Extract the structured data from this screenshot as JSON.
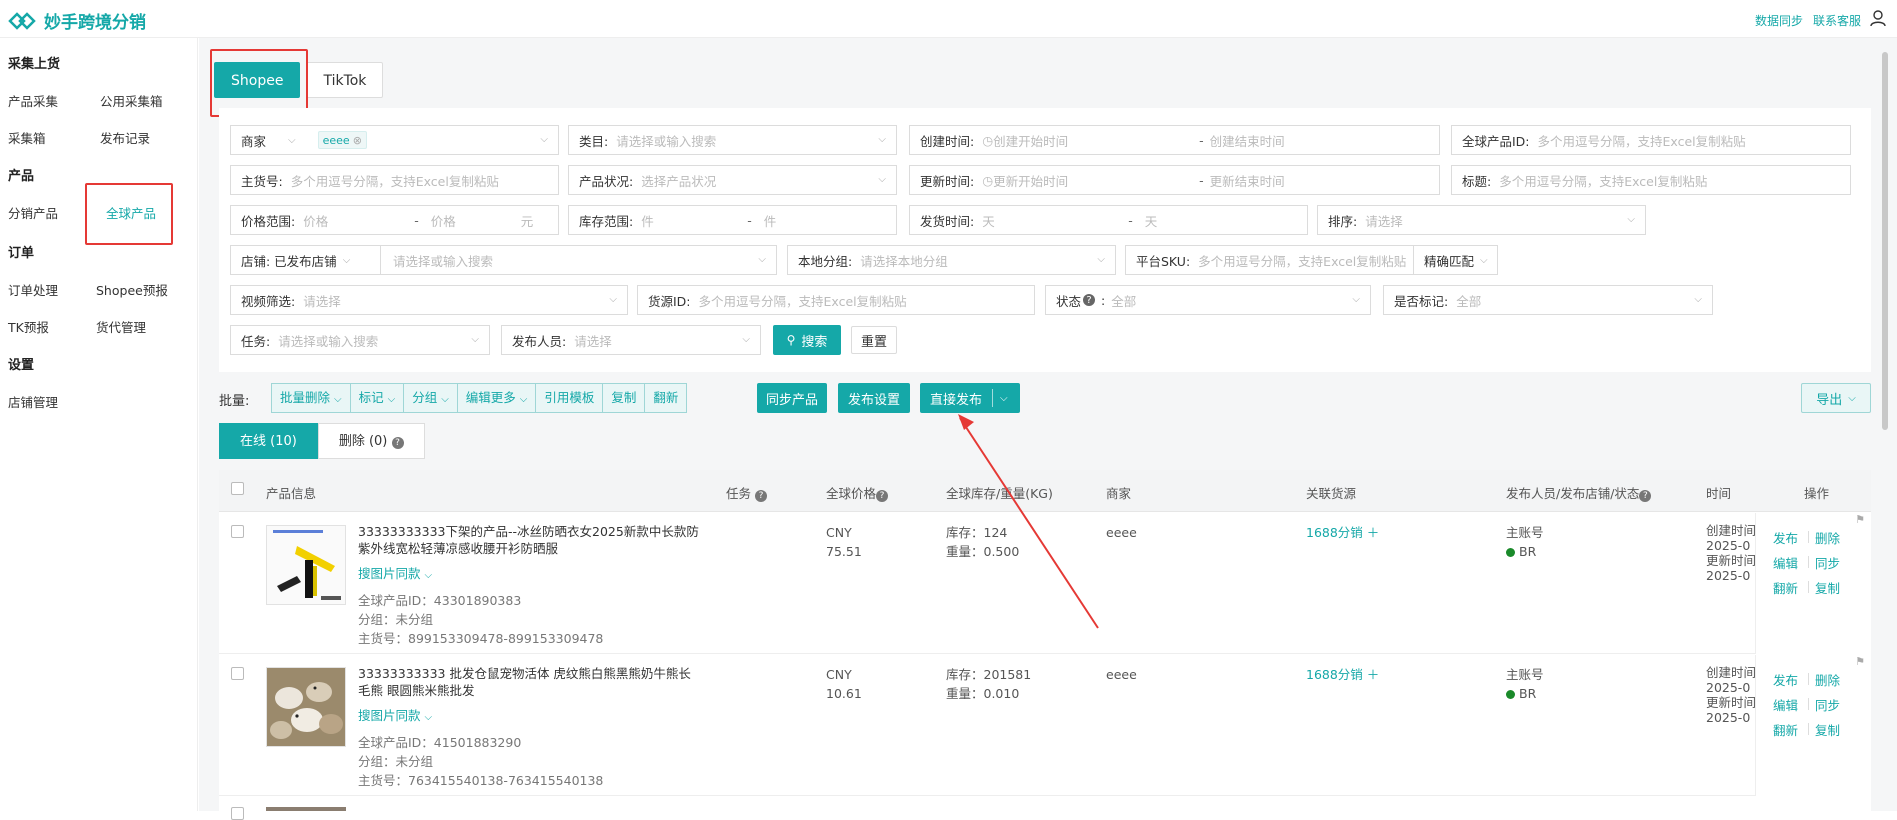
{
  "app": {
    "name": "妙手跨境分销",
    "links": [
      "数据同步",
      "联系客服"
    ]
  },
  "sidebar": {
    "sections": [
      {
        "title": "采集上货",
        "items": [
          "产品采集",
          "公用采集箱",
          "采集箱",
          "发布记录"
        ]
      },
      {
        "title": "产品",
        "items": [
          "分销产品",
          "全球产品"
        ]
      },
      {
        "title": "订单",
        "items": [
          "订单处理",
          "Shopee预报",
          "TK预报",
          "货代管理"
        ]
      },
      {
        "title": "设置",
        "items": [
          "店铺管理"
        ]
      }
    ],
    "active": "全球产品"
  },
  "platform_tabs": [
    "Shopee",
    "TikTok"
  ],
  "filters": {
    "merchant_label": "商家",
    "merchant_tag": "eeee",
    "category_label": "类目:",
    "category_ph": "请选择或输入搜索",
    "created_label": "创建时间:",
    "created_start_ph": "创建开始时间",
    "created_end_ph": "创建结束时间",
    "global_id_label": "全球产品ID:",
    "multi_ph": "多个用逗号分隔，支持Excel复制粘贴",
    "main_sku_label": "主货号:",
    "status_label": "产品状况:",
    "status_ph": "选择产品状况",
    "updated_label": "更新时间:",
    "updated_start_ph": "更新开始时间",
    "updated_end_ph": "更新结束时间",
    "title_label": "标题:",
    "price_label": "价格范围:",
    "price_ph": "价格",
    "price_unit": "元",
    "stock_label": "库存范围:",
    "stock_ph": "件",
    "ship_label": "发货时间:",
    "ship_ph": "天",
    "sort_label": "排序:",
    "sort_ph": "请选择",
    "shop_label": "店铺: 已发布店铺",
    "shop_ph": "请选择或输入搜索",
    "local_group_label": "本地分组:",
    "local_group_ph": "请选择本地分组",
    "platform_sku_label": "平台SKU:",
    "exact_match": "精确匹配",
    "video_label": "视频筛选:",
    "select_ph": "请选择",
    "source_id_label": "货源ID:",
    "state_label": "状态",
    "all_ph": "全部",
    "flag_label": "是否标记:",
    "task_label": "任务:",
    "publisher_label": "发布人员:",
    "dash": "-",
    "search_btn": "搜索",
    "reset_btn": "重置"
  },
  "batch": {
    "label": "批量:",
    "group": [
      "批量删除",
      "标记",
      "分组",
      "编辑更多",
      "引用模板",
      "复制",
      "翻新"
    ],
    "sync": "同步产品",
    "publish_settings": "发布设置",
    "direct_publish": "直接发布",
    "export": "导出"
  },
  "status_tabs": [
    "在线 (10)",
    "删除 (0)"
  ],
  "table": {
    "headers": [
      "产品信息",
      "任务",
      "全球价格",
      "全球库存/重量(KG)",
      "商家",
      "关联货源",
      "发布人员/发布店铺/状态",
      "时间",
      "操作"
    ],
    "rows": [
      {
        "name": "33333333333下架的产品--冰丝防晒衣女2025新款中长款防紫外线宽松轻薄凉感收腰开衫防晒服",
        "search_same": "搜图片同款",
        "global_id": "全球产品ID：43301890383",
        "group": "分组：未分组",
        "main_sku": "主货号：899153309478-899153309478",
        "currency": "CNY",
        "price": "75.51",
        "stock": "库存：124",
        "weight": "重量：0.500",
        "merchant": "eeee",
        "source": "1688分销",
        "publisher": "主账号",
        "store": "BR",
        "time": [
          "创建时间",
          "2025-0",
          "更新时间",
          "2025-0"
        ]
      },
      {
        "name": "33333333333 批发仓鼠宠物活体 虎纹熊白熊黑熊奶牛熊长毛熊 眼圆熊米熊批发",
        "search_same": "搜图片同款",
        "global_id": "全球产品ID：41501883290",
        "group": "分组：未分组",
        "main_sku": "主货号：763415540138-763415540138",
        "currency": "CNY",
        "price": "10.61",
        "stock": "库存：201581",
        "weight": "重量：0.010",
        "merchant": "eeee",
        "source": "1688分销",
        "publisher": "主账号",
        "store": "BR",
        "time": [
          "创建时间",
          "2025-0",
          "更新时间",
          "2025-0"
        ]
      }
    ],
    "ops": [
      "发布",
      "删除",
      "编辑",
      "同步",
      "翻新",
      "复制"
    ]
  },
  "colors": {
    "accent": "#15a8a8",
    "annotation": "#e53935",
    "status_dot": "#1a8a2a"
  }
}
